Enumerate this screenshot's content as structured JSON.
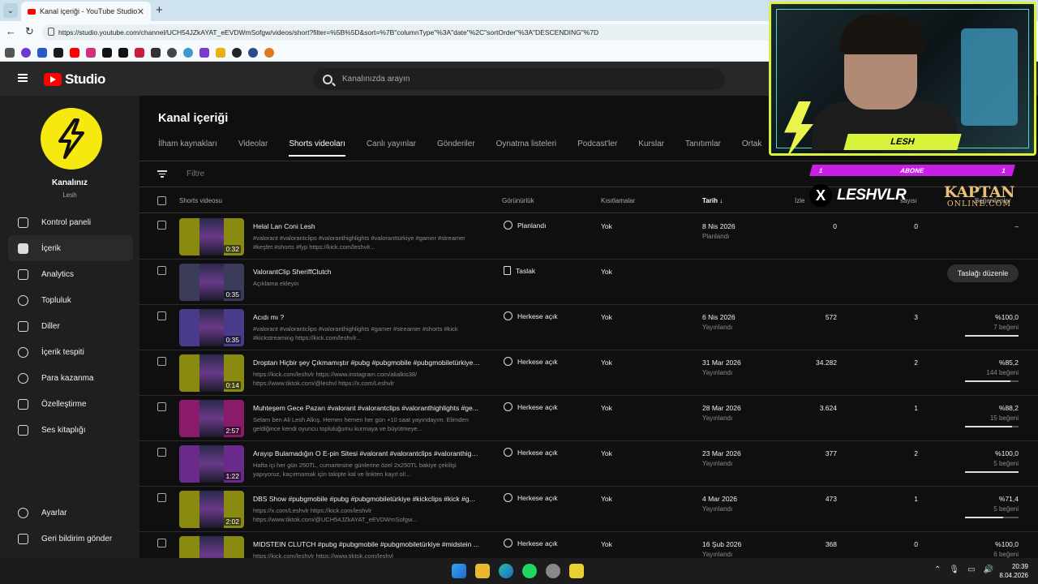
{
  "browser": {
    "tab_title": "Kanal içeriği - YouTube Studio",
    "url": "https://studio.youtube.com/channel/UCH54JZkAYAT_eEVDWmSofgw/videos/short?filter=%5B%5D&sort=%7B\"columnType\"%3A\"date\"%2C\"sortOrder\"%3A\"DESCENDING\"%7D"
  },
  "studio": {
    "logo_text": "Studio",
    "search_placeholder": "Kanalınızda arayın",
    "channel_title": "Kanalınız",
    "channel_name": "Lesh"
  },
  "sidebar": {
    "items": [
      {
        "label": "Kontrol paneli",
        "icon": "dashboard-icon"
      },
      {
        "label": "İçerik",
        "icon": "content-icon"
      },
      {
        "label": "Analytics",
        "icon": "analytics-icon"
      },
      {
        "label": "Topluluk",
        "icon": "community-icon"
      },
      {
        "label": "Diller",
        "icon": "subtitles-icon"
      },
      {
        "label": "İçerik tespiti",
        "icon": "copyright-icon"
      },
      {
        "label": "Para kazanma",
        "icon": "dollar-icon"
      },
      {
        "label": "Özelleştirme",
        "icon": "customization-icon"
      },
      {
        "label": "Ses kitaplığı",
        "icon": "audio-library-icon"
      }
    ],
    "bottom": [
      {
        "label": "Ayarlar",
        "icon": "gear-icon"
      },
      {
        "label": "Geri bildirim gönder",
        "icon": "feedback-icon"
      }
    ]
  },
  "main": {
    "title": "Kanal içeriği",
    "tabs": [
      "İlham kaynakları",
      "Videolar",
      "Shorts videoları",
      "Canlı yayınlar",
      "Gönderiler",
      "Oynatma listeleri",
      "Podcast'ler",
      "Kurslar",
      "Tanıtımlar",
      "Ortak"
    ],
    "active_tab": "Shorts videoları",
    "filter_placeholder": "Filtre",
    "columns": {
      "video": "Shorts videosu",
      "visibility": "Görünürlük",
      "restrictions": "Kısıtlamalar",
      "date": "Tarih",
      "views": "İzle",
      "comments": "sayısı",
      "likes": "Beğenilenler"
    },
    "rows": [
      {
        "title": "Helal Lan Coni Lesh",
        "desc": "#valorant #valorantclips #valoranthighlights #valoranttürkiye #gamer #streamer #keşfet #shorts #fyp https://kick.com/leshvlr...",
        "duration": "0:32",
        "visibility": "Planlandı",
        "vis_icon": "clock-icon",
        "restriction": "Yok",
        "date": "8 Nis 2026",
        "date_sub": "Planlandı",
        "views": "0",
        "comments": "0",
        "likes": "–",
        "likes_sub": "",
        "like_ratio": null,
        "thumb_color": "#8a8a10"
      },
      {
        "title": "ValorantClip SheriffClutch",
        "desc": "Açıklama ekleyin",
        "duration": "0:35",
        "visibility": "Taslak",
        "vis_icon": "draft-icon",
        "restriction": "Yok",
        "date": "",
        "date_sub": "",
        "views": "",
        "comments": "",
        "likes": "",
        "likes_sub": "",
        "like_ratio": null,
        "edit_label": "Taslağı düzenle",
        "thumb_color": "#3b3b5a"
      },
      {
        "title": "Acıdı mı ?",
        "desc": "#valorant #valorantclips #valoranthighlights #gamer #streamer #shorts #kick #kickstreaming https://kick.com/leshvlr...",
        "duration": "0:35",
        "visibility": "Herkese açık",
        "vis_icon": "globe-icon",
        "restriction": "Yok",
        "date": "6 Nis 2026",
        "date_sub": "Yayınlandı",
        "views": "572",
        "comments": "3",
        "likes": "%100,0",
        "likes_sub": "7 beğeni",
        "like_ratio": 1.0,
        "thumb_color": "#4a3a8a"
      },
      {
        "title": "Droptan Hiçbir şey Çıkmamıştır #pubg #pubgmobile #pubgmobiletürkiye ...",
        "desc": "https://kick.com/leshvlr https://www.instagram.com/alialkis38/ https://www.tiktok.com/@leshvl https://x.com/Leshvlr",
        "duration": "0:14",
        "visibility": "Herkese açık",
        "vis_icon": "globe-icon",
        "restriction": "Yok",
        "date": "31 Mar 2026",
        "date_sub": "Yayınlandı",
        "views": "34.282",
        "comments": "2",
        "likes": "%85,2",
        "likes_sub": "144 beğeni",
        "like_ratio": 0.852,
        "thumb_color": "#8a8a10"
      },
      {
        "title": "Muhteşem Gece Pazarı #valorant #valorantclips #valoranthighlights #ge...",
        "desc": "Selam ben Ali Lesh Alkış. Hemen hemen her gün +10 saat yayındayım. Elimden geldiğince kendi oyuncu topluluğumu kurmaya ve büyütmeye...",
        "duration": "2:57",
        "visibility": "Herkese açık",
        "vis_icon": "globe-icon",
        "restriction": "Yok",
        "date": "28 Mar 2026",
        "date_sub": "Yayınlandı",
        "views": "3.624",
        "comments": "1",
        "likes": "%88,2",
        "likes_sub": "15 beğeni",
        "like_ratio": 0.882,
        "thumb_color": "#8a1a6a"
      },
      {
        "title": "Arayıp Bulamadığın O E-pin Sitesi #valorant #valorantclips #valoranthighli...",
        "desc": "Hafta içi her gün 250TL, cumartesine günlerine özel 2x250TL bakiye çekilişi yapıyoruz, kaçırmamak için takipte kal ve linkten kayıt ol!...",
        "duration": "1:22",
        "visibility": "Herkese açık",
        "vis_icon": "globe-icon",
        "restriction": "Yok",
        "date": "23 Mar 2026",
        "date_sub": "Yayınlandı",
        "views": "377",
        "comments": "2",
        "likes": "%100,0",
        "likes_sub": "5 beğeni",
        "like_ratio": 1.0,
        "thumb_color": "#6a2a8a"
      },
      {
        "title": "DBS Show #pubgmobile #pubg #pubgmobiletürkiye #kickclips #kick #g...",
        "desc": "https://x.com/Leshvlr https://kick.com/leshvlr https://www.tiktok.com/@UCH54JZkAYAT_eEVDWmSofgw...",
        "duration": "2:02",
        "visibility": "Herkese açık",
        "vis_icon": "globe-icon",
        "restriction": "Yok",
        "date": "4 Mar 2026",
        "date_sub": "Yayınlandı",
        "views": "473",
        "comments": "1",
        "likes": "%71,4",
        "likes_sub": "5 beğeni",
        "like_ratio": 0.714,
        "thumb_color": "#8a8a10"
      },
      {
        "title": "MIDSTEIN CLUTCH #pubg #pubgmobile #pubgmobiletürkiye #midstein ...",
        "desc": "https://kick.com/leshvlr https://www.tiktok.com/leshvl",
        "duration": "",
        "visibility": "Herkese açık",
        "vis_icon": "globe-icon",
        "restriction": "Yok",
        "date": "16 Şub 2026",
        "date_sub": "Yayınlandı",
        "views": "368",
        "comments": "0",
        "likes": "%100,0",
        "likes_sub": "6 beğeni",
        "like_ratio": 1.0,
        "thumb_color": "#8a8a10"
      }
    ]
  },
  "overlay": {
    "streamer_name": "LESH",
    "abone_label": "ABONE",
    "abone_left": "1",
    "abone_right": "1",
    "x_handle": "LESHVLR",
    "x_logo": "X",
    "sponsor_line1": "KAPTAN",
    "sponsor_line2": "ONLINE.COM"
  },
  "taskbar": {
    "time": "20:39",
    "date": "8.04.2026"
  },
  "colors": {
    "accent_yellow": "#d8f33a",
    "abone_purple": "#c81fe6",
    "yt_red": "#ff0000"
  }
}
